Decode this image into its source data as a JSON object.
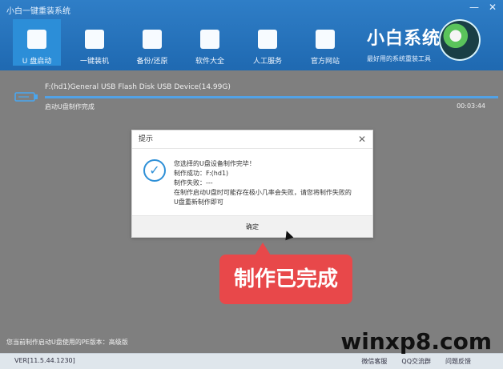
{
  "window": {
    "title": "小白一键重装系统"
  },
  "header": {
    "nav": [
      "U 盘启动",
      "一键装机",
      "备份/还原",
      "软件大全",
      "人工服务",
      "官方网站"
    ],
    "brand_main": "小白系统",
    "brand_sub": "最好用的系统重装工具"
  },
  "device": {
    "name": "F:(hd1)General USB Flash Disk USB Device(14.99G)",
    "status": "启动U盘制作完成",
    "time": "00:03:44",
    "progress": 100
  },
  "dialog": {
    "title": "提示",
    "message": "您选择的U盘设备制作完毕！\n制作成功：F:(hd1)\n制作失败：---\n在制作启动U盘时可能存在极小几率会失败，请您将制作失败的\nU盘重新制作即可",
    "ok_label": "确定"
  },
  "overlay": {
    "callout": "制作已完成",
    "watermark": "winxp8.com"
  },
  "footer": {
    "info": "您当前制作启动U盘使用的PE版本：高级版",
    "version": "VER[11.5.44.1230]",
    "links": [
      "微信客服",
      "QQ交流群",
      "问题反馈"
    ]
  }
}
